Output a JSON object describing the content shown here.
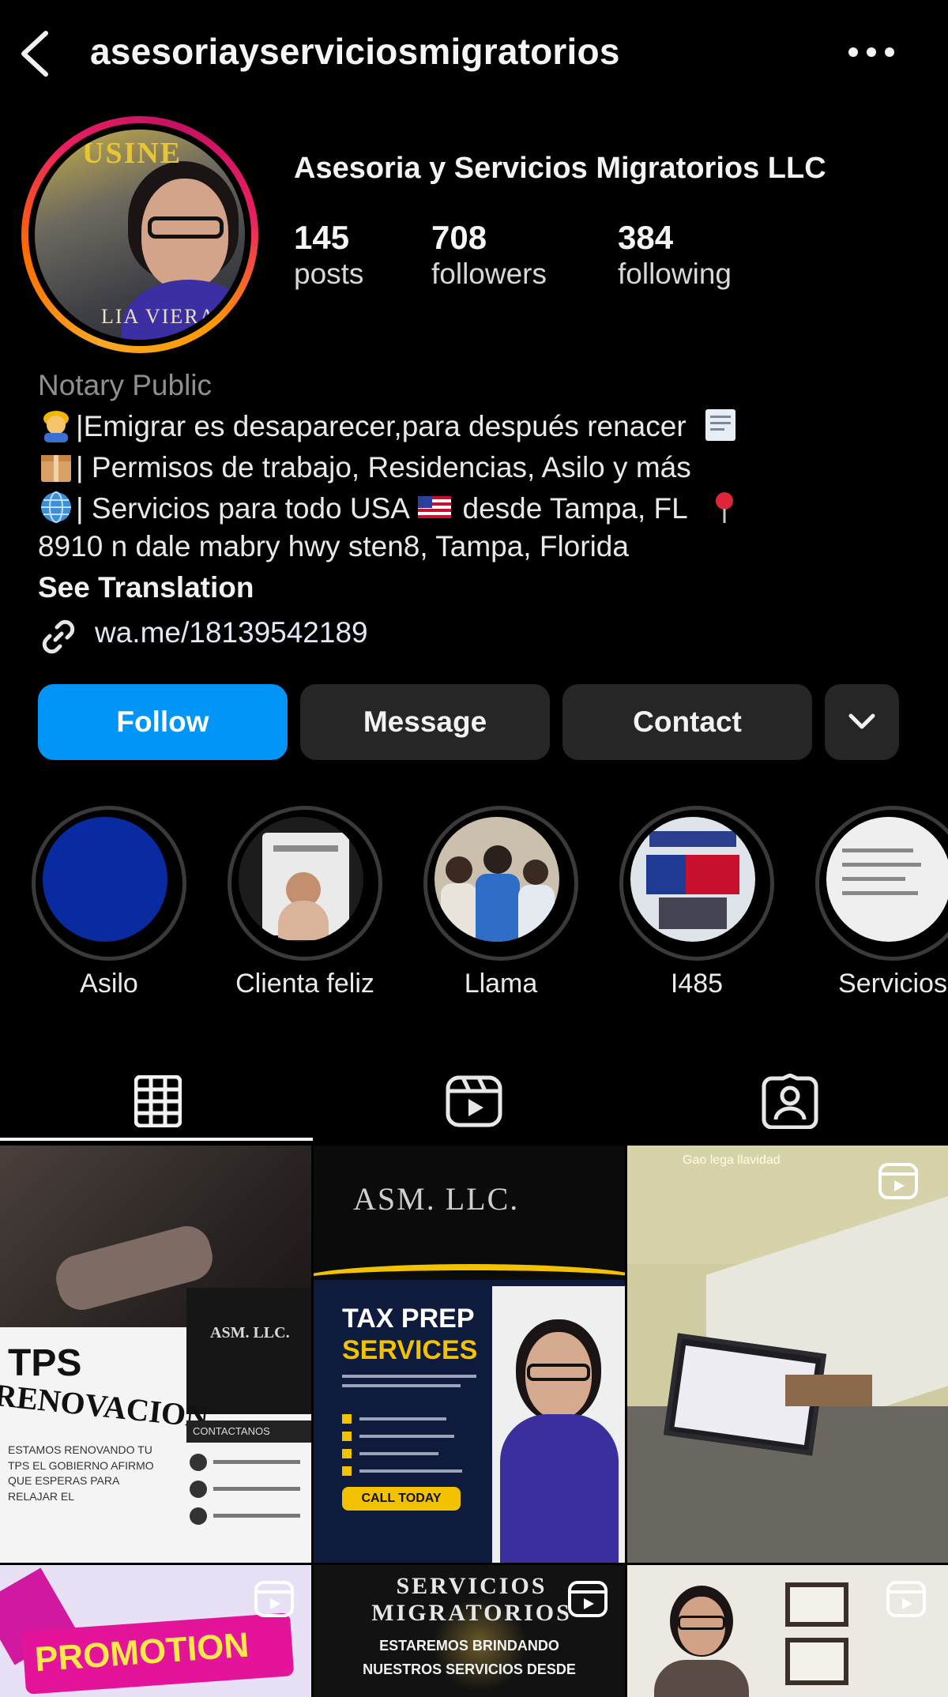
{
  "header": {
    "username": "asesoriayserviciosmigratorios",
    "back_icon": "chevron-left-icon",
    "more_icon": "more-horizontal-icon"
  },
  "profile": {
    "full_name": "Asesoria y Servicios Migratorios LLC",
    "avatar_text_top": "USINE",
    "avatar_text_bottom": "LIA VIERA",
    "stats": [
      {
        "value": "145",
        "label": "posts"
      },
      {
        "value": "708",
        "label": "followers"
      },
      {
        "value": "384",
        "label": "following"
      }
    ]
  },
  "bio": {
    "category": "Notary Public",
    "line1": "|Emigrar es desaparecer,para después renacer",
    "line2": "| Permisos de trabajo, Residencias, Asilo y más",
    "line3a": "| Servicios para todo USA",
    "line3b": " desde Tampa, FL",
    "line4": "8910 n dale mabry hwy sten8, Tampa, Florida",
    "see_translation": "See Translation",
    "link": "wa.me/18139542189"
  },
  "buttons": {
    "follow": "Follow",
    "message": "Message",
    "contact": "Contact"
  },
  "highlights": [
    {
      "label": "Asilo"
    },
    {
      "label": "Clienta feliz"
    },
    {
      "label": "Llama"
    },
    {
      "label": "I485"
    },
    {
      "label": "Servicios"
    }
  ],
  "tabs": [
    "grid-icon",
    "reels-icon",
    "tagged-icon"
  ],
  "posts": [
    {
      "title": "TPS",
      "subtitle": "RENOVACION",
      "body": "ESTAMOS RENOVANDO TU TPS EL GOBIERNO AFIRMO QUE ESPERAS PARA RELAJAR EL",
      "contact": "CONTACTANOS"
    },
    {
      "brand": "ASM. LLC.",
      "headline1": "TAX PREP",
      "headline2": "SERVICES",
      "cta": "CALL TODAY"
    },
    {
      "caption": "Gao lega llavidad"
    },
    {
      "title": "PROMOTION"
    },
    {
      "title": "SERVICIOS MIGRATORIOS",
      "body1": "ESTAREMOS BRINDANDO",
      "body2": "NUESTROS SERVICIOS DESDE"
    },
    {
      "caption": ""
    }
  ]
}
